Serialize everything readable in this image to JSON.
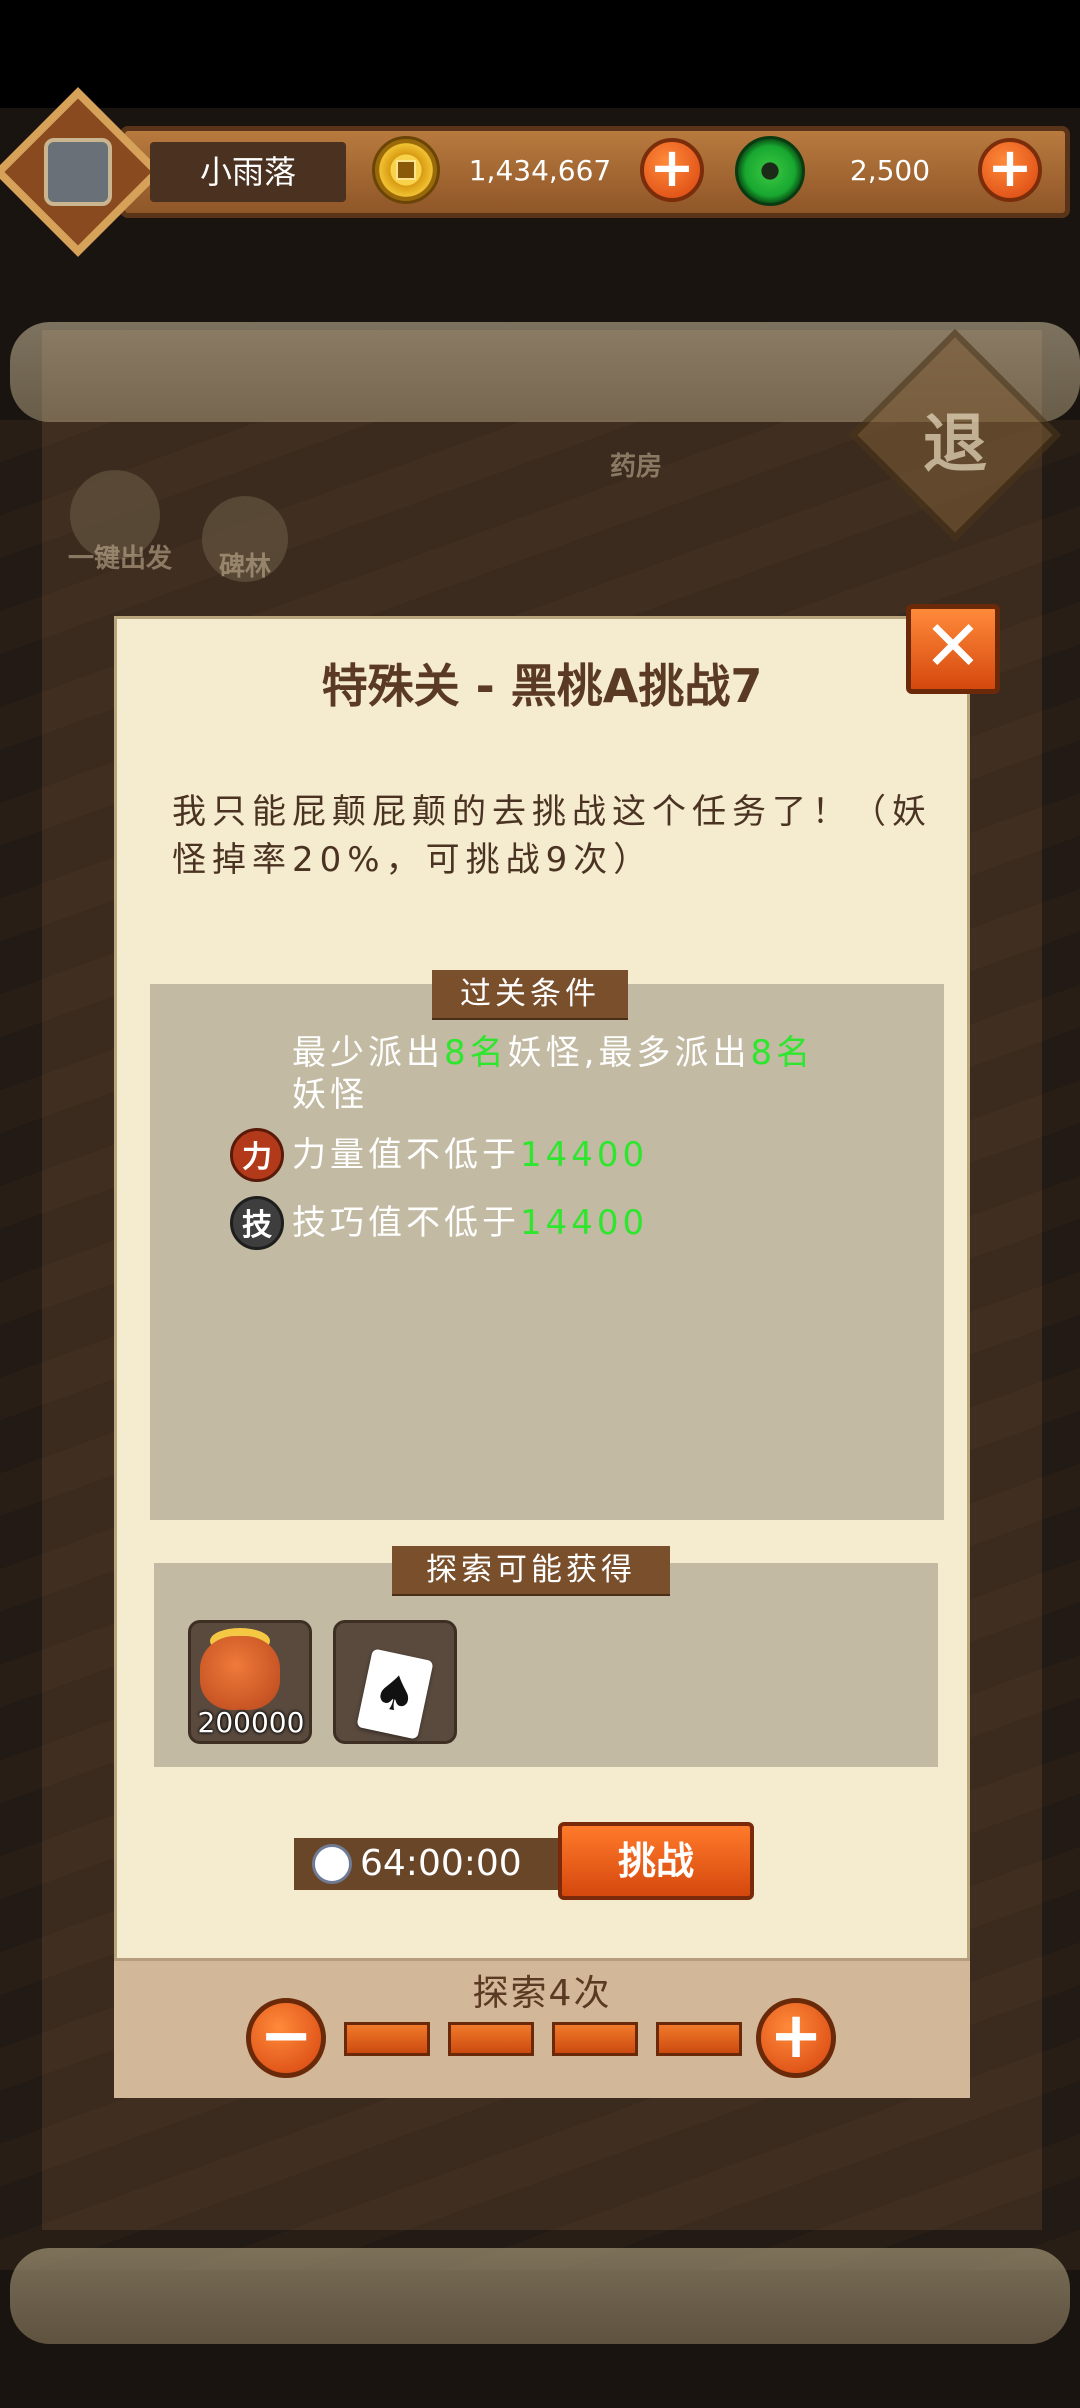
{
  "header": {
    "player_name": "小雨落",
    "coins": "1,434,667",
    "jade": "2,500",
    "plus": "+"
  },
  "background": {
    "quick_start": "一键出发",
    "stele_forest": "碑林",
    "pharmacy": "药房",
    "exit": "退"
  },
  "dialog": {
    "title": "特殊关 - 黑桃A挑战7",
    "description": "我只能屁颠屁颠的去挑战这个任务了！（妖怪掉率20%，可挑战9次）",
    "conditions_title": "过关条件",
    "dispatch_prefix": "最少派出",
    "dispatch_min": "8名",
    "dispatch_mid": "妖怪,最多派出",
    "dispatch_max": "8名",
    "dispatch_suffix": "妖怪",
    "power_icon": "力",
    "power_text": "力量值不低于",
    "power_value": "14400",
    "skill_icon": "技",
    "skill_text": "技巧值不低于",
    "skill_value": "14400",
    "rewards_title": "探索可能获得",
    "rewards": [
      {
        "icon": "gold-bag-icon",
        "amount": "200000"
      },
      {
        "icon": "spade-card-icon",
        "symbol": "♠"
      }
    ],
    "timer": "64:00:00",
    "challenge_label": "挑战",
    "explore_label": "探索4次",
    "explore_count": 4,
    "close": "✕",
    "minus": "−",
    "plus": "+"
  },
  "colors": {
    "accent_orange": "#d5480e",
    "highlight_green": "#2ee62e",
    "panel_tan": "#c2baa2",
    "dialog_bg": "#f5ebcf"
  }
}
